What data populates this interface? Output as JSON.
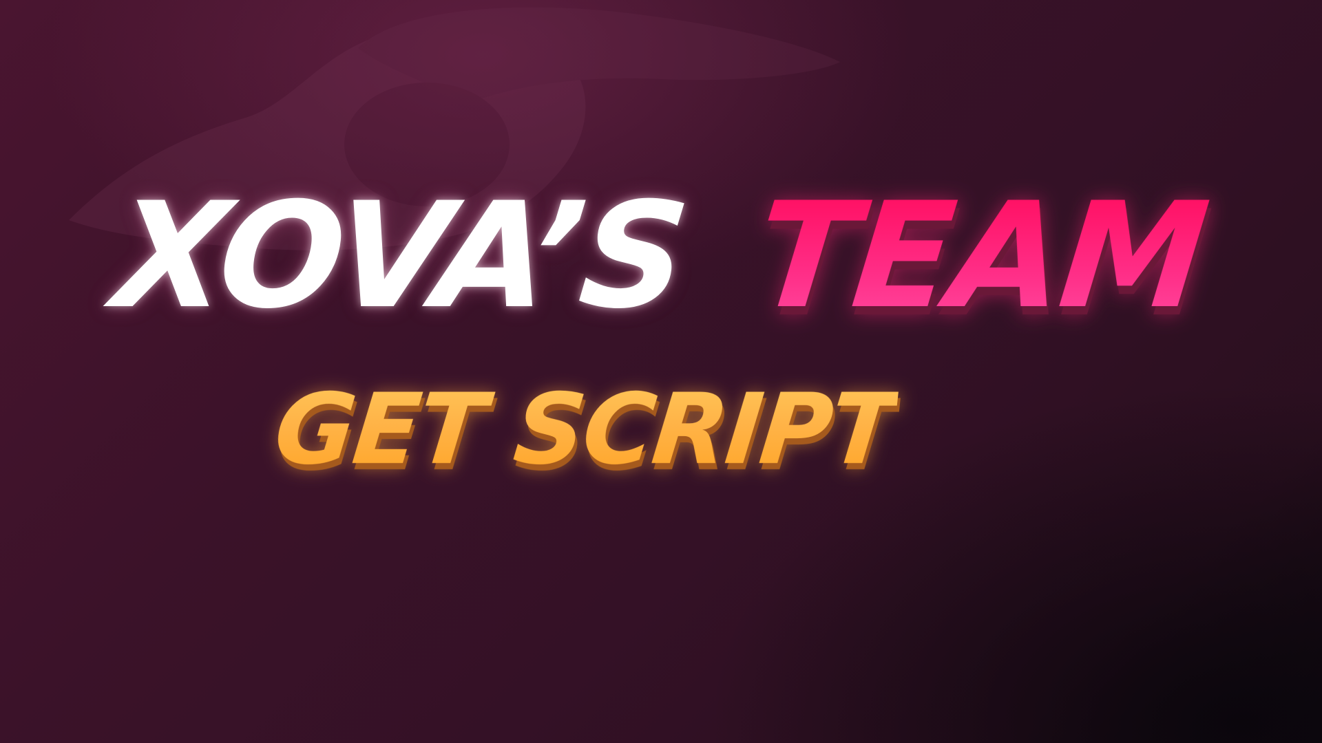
{
  "title": {
    "part_white": "XOVA’S",
    "part_accent": "TEAM"
  },
  "cta": {
    "label": "GET SCRIPT"
  },
  "colors": {
    "background": "#3a1428",
    "title_white": "#ffffff",
    "title_accent": "#ff1a78",
    "cta": "#ffb347"
  },
  "icons": {
    "background_art": "faint-silhouette"
  }
}
